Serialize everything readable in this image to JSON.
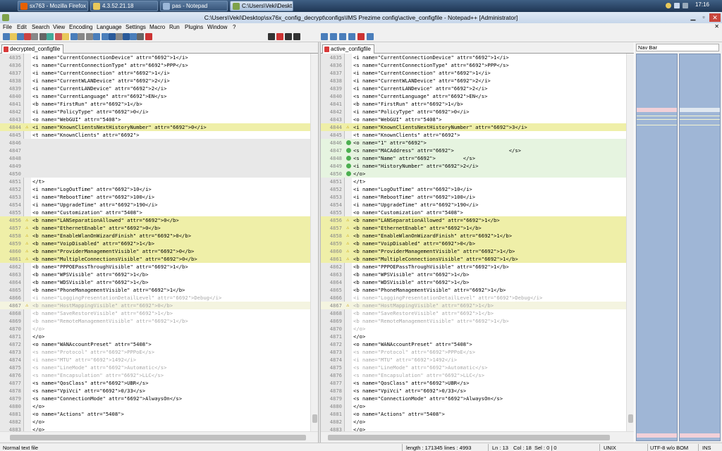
{
  "taskbar": {
    "tabs": [
      {
        "label": "sx763 - Mozilla Firefox",
        "icon": "firefox-icon",
        "color": "#e66000"
      },
      {
        "label": "4.3.52.21.18",
        "icon": "notepad-icon",
        "color": "#e8c85a"
      },
      {
        "label": "pas - Notepad",
        "icon": "notepad-icon",
        "color": "#9bb7d8"
      },
      {
        "label": "C:\\Users\\Veki\\Deskt...",
        "icon": "notepadpp-icon",
        "color": "#7ea24a"
      }
    ],
    "clock": "17:16"
  },
  "window": {
    "title": "C:\\Users\\Veki\\Desktop\\sx76x_config_decrypt\\configs\\IMS Prezime config\\active_configfile - Notepad++ [Administrator]"
  },
  "menu": [
    "File",
    "Edit",
    "Search",
    "View",
    "Encoding",
    "Language",
    "Settings",
    "Macro",
    "Run",
    "Plugins",
    "Window",
    "?"
  ],
  "left": {
    "tab": "decrypted_configfile",
    "lines": [
      {
        "n": "4835",
        "t": "<i name=\"CurrentConnectionDevice\" attr=\"6692\">1</i>",
        "s": ""
      },
      {
        "n": "4836",
        "t": "<s name=\"CurrentConnectionType\" attr=\"6692\">PPP</s>",
        "s": ""
      },
      {
        "n": "4837",
        "t": "<i name=\"CurrentConnection\" attr=\"6692\">1</i>",
        "s": ""
      },
      {
        "n": "4838",
        "t": "<i name=\"CurrentWLANDevice\" attr=\"6692\">2</i>",
        "s": ""
      },
      {
        "n": "4839",
        "t": "<i name=\"CurrentLANDevice\" attr=\"6692\">2</i>",
        "s": ""
      },
      {
        "n": "4840",
        "t": "<s name=\"CurrentLanguage\" attr=\"6692\">EN</s>",
        "s": ""
      },
      {
        "n": "4841",
        "t": "<b name=\"FirstRun\" attr=\"6692\">1</b>",
        "s": ""
      },
      {
        "n": "4842",
        "t": "<i name=\"PolicyType\" attr=\"6692\">0</i>",
        "s": ""
      },
      {
        "n": "4843",
        "t": "<o name=\"WebGUI\" attr=\"5408\">",
        "s": ""
      },
      {
        "n": "4844",
        "t": "<i name=\"KnownClientsNextHistoryNumber\" attr=\"6692\">0</i>",
        "s": "mod"
      },
      {
        "n": "4845",
        "t": "<t name=\"KnownClients\" attr=\"6692\">",
        "s": ""
      },
      {
        "n": "4846",
        "t": "",
        "s": "empty"
      },
      {
        "n": "4847",
        "t": "",
        "s": "empty"
      },
      {
        "n": "4848",
        "t": "",
        "s": "empty"
      },
      {
        "n": "4849",
        "t": "",
        "s": "empty"
      },
      {
        "n": "4850",
        "t": "",
        "s": "empty"
      },
      {
        "n": "4851",
        "t": "</t>",
        "s": ""
      },
      {
        "n": "4852",
        "t": "<i name=\"LogOutTime\" attr=\"6692\">10</i>",
        "s": ""
      },
      {
        "n": "4853",
        "t": "<i name=\"RebootTime\" attr=\"6692\">100</i>",
        "s": ""
      },
      {
        "n": "4854",
        "t": "<i name=\"UpgradeTime\" attr=\"6692\">190</i>",
        "s": ""
      },
      {
        "n": "4855",
        "t": "<o name=\"Customization\" attr=\"5408\">",
        "s": ""
      },
      {
        "n": "4856",
        "t": "<b name=\"LANSeparationAllowed\" attr=\"6692\">0</b>",
        "s": "mod"
      },
      {
        "n": "4857",
        "t": "<b name=\"EthernetEnable\" attr=\"6692\">0</b>",
        "s": "mod"
      },
      {
        "n": "4858",
        "t": "<b name=\"EnableWlanOnWizardFinish\" attr=\"6692\">0</b>",
        "s": "mod"
      },
      {
        "n": "4859",
        "t": "<b name=\"VoipDisabled\" attr=\"6692\">1</b>",
        "s": "mod"
      },
      {
        "n": "4860",
        "t": "<b name=\"ProviderManagementVisible\" attr=\"6692\">0</b>",
        "s": "mod"
      },
      {
        "n": "4861",
        "t": "<b name=\"MultipleConnectionsVisible\" attr=\"6692\">0</b>",
        "s": "mod"
      },
      {
        "n": "4862",
        "t": "<b name=\"PPPOEPassThroughVisible\" attr=\"6692\">1</b>",
        "s": ""
      },
      {
        "n": "4863",
        "t": "<b name=\"WPSVisible\" attr=\"6692\">1</b>",
        "s": ""
      },
      {
        "n": "4864",
        "t": "<b name=\"WDSVisible\" attr=\"6692\">1</b>",
        "s": ""
      },
      {
        "n": "4865",
        "t": "<b name=\"PhoneManagementVisible\" attr=\"6692\">1</b>",
        "s": ""
      },
      {
        "n": "4866",
        "t": "<i name=\"LoggingPresentationDetailLevel\" attr=\"6692\">Debug</i>",
        "s": "dim"
      },
      {
        "n": "4867",
        "t": "<b name=\"HostMappingVisible\" attr=\"6692\">0</b>",
        "s": "moved"
      },
      {
        "n": "4868",
        "t": "<b name=\"SaveRestoreVisible\" attr=\"6692\">1</b>",
        "s": "dim"
      },
      {
        "n": "4869",
        "t": "<b name=\"RemoteManagementVisible\" attr=\"6692\">1</b>",
        "s": "dim"
      },
      {
        "n": "4870",
        "t": "</o>",
        "s": "dim"
      },
      {
        "n": "4871",
        "t": "</o>",
        "s": ""
      },
      {
        "n": "4872",
        "t": "<o name=\"WANAccountPreset\" attr=\"5408\">",
        "s": ""
      },
      {
        "n": "4873",
        "t": "<s name=\"Protocol\" attr=\"6692\">PPPoE</s>",
        "s": "dim"
      },
      {
        "n": "4874",
        "t": "<i name=\"MTU\" attr=\"6692\">1492</i>",
        "s": "dim"
      },
      {
        "n": "4875",
        "t": "<s name=\"LineMode\" attr=\"6692\">Automatic</s>",
        "s": "dim"
      },
      {
        "n": "4876",
        "t": "<s name=\"Encapsulation\" attr=\"6692\">LLC</s>",
        "s": "dim"
      },
      {
        "n": "4877",
        "t": "<s name=\"QosClass\" attr=\"6692\">UBR</s>",
        "s": ""
      },
      {
        "n": "4878",
        "t": "<s name=\"VpiVci\" attr=\"6692\">0/33</s>",
        "s": ""
      },
      {
        "n": "4879",
        "t": "<s name=\"ConnectionMode\" attr=\"6692\">AlwaysOn</s>",
        "s": ""
      },
      {
        "n": "4880",
        "t": "</o>",
        "s": ""
      },
      {
        "n": "4881",
        "t": "<o name=\"Actions\" attr=\"5408\">",
        "s": ""
      },
      {
        "n": "4882",
        "t": "</o>",
        "s": ""
      },
      {
        "n": "4883",
        "t": "</o>",
        "s": ""
      }
    ]
  },
  "right": {
    "tab": "active_configfile",
    "lines": [
      {
        "n": "4835",
        "t": "<i name=\"CurrentConnectionDevice\" attr=\"6692\">1</i>",
        "s": ""
      },
      {
        "n": "4836",
        "t": "<s name=\"CurrentConnectionType\" attr=\"6692\">PPP</s>",
        "s": ""
      },
      {
        "n": "4837",
        "t": "<i name=\"CurrentConnection\" attr=\"6692\">1</i>",
        "s": ""
      },
      {
        "n": "4838",
        "t": "<i name=\"CurrentWLANDevice\" attr=\"6692\">2</i>",
        "s": ""
      },
      {
        "n": "4839",
        "t": "<i name=\"CurrentLANDevice\" attr=\"6692\">2</i>",
        "s": ""
      },
      {
        "n": "4840",
        "t": "<s name=\"CurrentLanguage\" attr=\"6692\">EN</s>",
        "s": ""
      },
      {
        "n": "4841",
        "t": "<b name=\"FirstRun\" attr=\"6692\">1</b>",
        "s": ""
      },
      {
        "n": "4842",
        "t": "<i name=\"PolicyType\" attr=\"6692\">0</i>",
        "s": ""
      },
      {
        "n": "4843",
        "t": "<o name=\"WebGUI\" attr=\"5408\">",
        "s": ""
      },
      {
        "n": "4844",
        "t": "<i name=\"KnownClientsNextHistoryNumber\" attr=\"6692\">3</i>",
        "s": "mod"
      },
      {
        "n": "4845",
        "t": "<t name=\"KnownClients\" attr=\"6692\">",
        "s": ""
      },
      {
        "n": "4846",
        "t": "<o name=\"1\" attr=\"6692\">",
        "s": "add"
      },
      {
        "n": "4847",
        "t": "<s name=\"MACAddress\" attr=\"6692\">                  </s>",
        "s": "add"
      },
      {
        "n": "4848",
        "t": "<s name=\"Name\" attr=\"6692\">         </s>",
        "s": "add"
      },
      {
        "n": "4849",
        "t": "<i name=\"HistoryNumber\" attr=\"6692\">2</i>",
        "s": "add"
      },
      {
        "n": "4850",
        "t": "</o>",
        "s": "add"
      },
      {
        "n": "4851",
        "t": "</t>",
        "s": ""
      },
      {
        "n": "4852",
        "t": "<i name=\"LogOutTime\" attr=\"6692\">10</i>",
        "s": ""
      },
      {
        "n": "4853",
        "t": "<i name=\"RebootTime\" attr=\"6692\">100</i>",
        "s": ""
      },
      {
        "n": "4854",
        "t": "<i name=\"UpgradeTime\" attr=\"6692\">190</i>",
        "s": ""
      },
      {
        "n": "4855",
        "t": "<o name=\"Customization\" attr=\"5408\">",
        "s": ""
      },
      {
        "n": "4856",
        "t": "<b name=\"LANSeparationAllowed\" attr=\"6692\">1</b>",
        "s": "mod"
      },
      {
        "n": "4857",
        "t": "<b name=\"EthernetEnable\" attr=\"6692\">1</b>",
        "s": "mod"
      },
      {
        "n": "4858",
        "t": "<b name=\"EnableWlanOnWizardFinish\" attr=\"6692\">1</b>",
        "s": "mod"
      },
      {
        "n": "4859",
        "t": "<b name=\"VoipDisabled\" attr=\"6692\">0</b>",
        "s": "mod"
      },
      {
        "n": "4860",
        "t": "<b name=\"ProviderManagementVisible\" attr=\"6692\">1</b>",
        "s": "mod"
      },
      {
        "n": "4861",
        "t": "<b name=\"MultipleConnectionsVisible\" attr=\"6692\">1</b>",
        "s": "mod"
      },
      {
        "n": "4862",
        "t": "<b name=\"PPPOEPassThroughVisible\" attr=\"6692\">1</b>",
        "s": ""
      },
      {
        "n": "4863",
        "t": "<b name=\"WPSVisible\" attr=\"6692\">1</b>",
        "s": ""
      },
      {
        "n": "4864",
        "t": "<b name=\"WDSVisible\" attr=\"6692\">1</b>",
        "s": ""
      },
      {
        "n": "4865",
        "t": "<b name=\"PhoneManagementVisible\" attr=\"6692\">1</b>",
        "s": ""
      },
      {
        "n": "4866",
        "t": "<i name=\"LoggingPresentationDetailLevel\" attr=\"6692\">Debug</i>",
        "s": "dim"
      },
      {
        "n": "4867",
        "t": "<b name=\"HostMappingVisible\" attr=\"6692\">1</b>",
        "s": "moved"
      },
      {
        "n": "4868",
        "t": "<b name=\"SaveRestoreVisible\" attr=\"6692\">1</b>",
        "s": "dim"
      },
      {
        "n": "4869",
        "t": "<b name=\"RemoteManagementVisible\" attr=\"6692\">1</b>",
        "s": "dim"
      },
      {
        "n": "4870",
        "t": "</o>",
        "s": "dim"
      },
      {
        "n": "4871",
        "t": "</o>",
        "s": ""
      },
      {
        "n": "4872",
        "t": "<o name=\"WANAccountPreset\" attr=\"5408\">",
        "s": ""
      },
      {
        "n": "4873",
        "t": "<s name=\"Protocol\" attr=\"6692\">PPPoE</s>",
        "s": "dim"
      },
      {
        "n": "4874",
        "t": "<i name=\"MTU\" attr=\"6692\">1492</i>",
        "s": "dim"
      },
      {
        "n": "4875",
        "t": "<s name=\"LineMode\" attr=\"6692\">Automatic</s>",
        "s": "dim"
      },
      {
        "n": "4876",
        "t": "<s name=\"Encapsulation\" attr=\"6692\">LLC</s>",
        "s": "dim"
      },
      {
        "n": "4877",
        "t": "<s name=\"QosClass\" attr=\"6692\">UBR</s>",
        "s": ""
      },
      {
        "n": "4878",
        "t": "<s name=\"VpiVci\" attr=\"6692\">0/33</s>",
        "s": ""
      },
      {
        "n": "4879",
        "t": "<s name=\"ConnectionMode\" attr=\"6692\">AlwaysOn</s>",
        "s": ""
      },
      {
        "n": "4880",
        "t": "</o>",
        "s": ""
      },
      {
        "n": "4881",
        "t": "<o name=\"Actions\" attr=\"5408\">",
        "s": ""
      },
      {
        "n": "4882",
        "t": "</o>",
        "s": ""
      },
      {
        "n": "4883",
        "t": "</o>",
        "s": ""
      }
    ]
  },
  "navbar": {
    "title": "Nav Bar"
  },
  "status": {
    "filetype": "Normal text file",
    "length": "length : 171345",
    "lines": "lines : 4993",
    "ln": "Ln : 13",
    "col": "Col : 18",
    "sel": "Sel : 0 | 0",
    "eol": "UNIX",
    "encoding": "UTF-8 w/o BOM",
    "mode": "INS"
  },
  "colors": {
    "modified": "#efefa8",
    "added": "#e6f4e0",
    "empty": "#e8e8e8",
    "nav_blue": "#9fb6d6"
  }
}
